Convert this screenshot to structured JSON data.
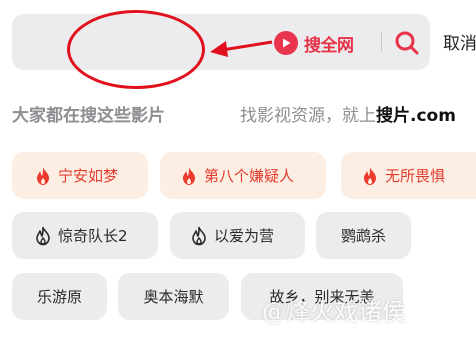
{
  "search": {
    "value": "",
    "placeholder": "",
    "all_web_label": "搜全网",
    "cancel_label": "取消"
  },
  "section": {
    "title": "大家都在搜这些影片",
    "promo_prefix": "找影视资源，就上",
    "promo_brand": "搜片.com"
  },
  "chips": {
    "row1": [
      "宁安如梦",
      "第八个嫌疑人",
      "无所畏惧"
    ],
    "row2": [
      "惊奇队长2",
      "以爱为营",
      "鹦鹉杀"
    ],
    "row3": [
      "乐游原",
      "奥本海默",
      "故乡，别来无恙"
    ]
  },
  "watermark": "@烽火戏诸侯",
  "colors": {
    "accent_red": "#e63347",
    "annotation_red": "#e0101c",
    "hot_chip_bg": "#fdeee4",
    "chip_bg": "#ececef"
  },
  "icons": {
    "play": "play-circle-icon",
    "search": "search-icon",
    "hot": "flame-icon",
    "trending": "flame-outline-icon"
  }
}
